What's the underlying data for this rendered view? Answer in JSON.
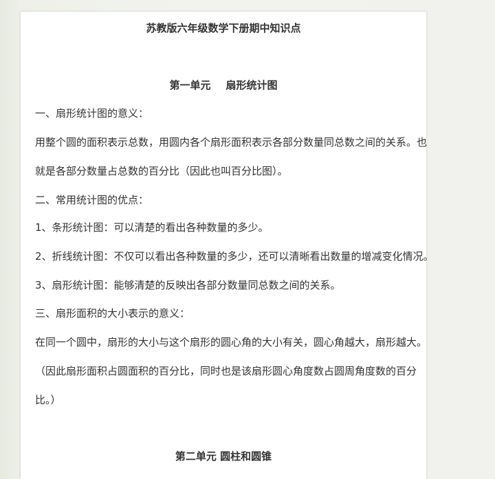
{
  "doc_title": "苏教版六年级数学下册期中知识点",
  "unit1": {
    "label": "第一单元",
    "name": "扇形统计图"
  },
  "lines": [
    "一、扇形统计图的意义：",
    "用整个圆的面积表示总数，用圆内各个扇形面积表示各部分数量同总数之间的关系。也",
    "就是各部分数量占总数的百分比（因此也叫百分比图）。",
    "二、常用统计图的优点：",
    "1、条形统计图：可以清楚的看出各种数量的多少。",
    "2、折线统计图：不仅可以看出各种数量的多少，还可以清晰看出数量的增减变化情况。",
    "3、扇形统计图：能够清楚的反映出各部分数量同总数之间的关系。",
    "三、扇形面积的大小表示的意义：",
    "在同一个圆中，扇形的大小与这个扇形的圆心角的大小有关，圆心角越大，扇形越大。",
    "（因此扇形面积占圆面积的百分比，同时也是该扇形圆心角度数占圆周角度数的百分",
    "比。）"
  ],
  "unit2_heading": "第二单元  圆柱和圆锥"
}
